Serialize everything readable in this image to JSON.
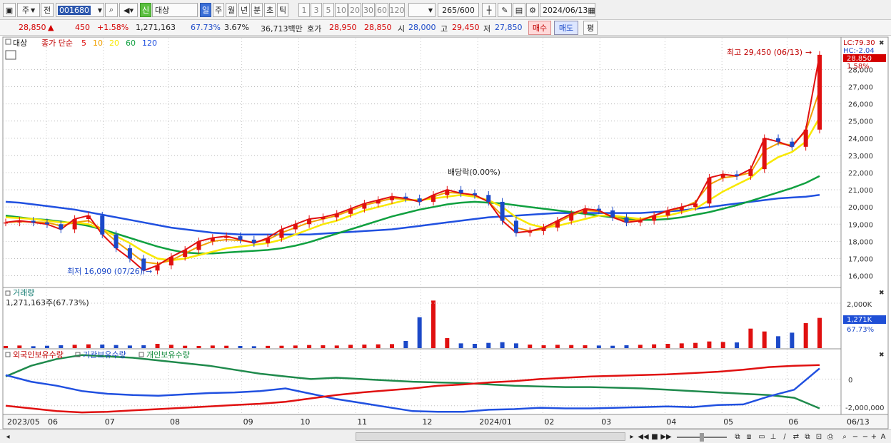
{
  "toolbar": {
    "type_select": "주",
    "mode_button": "전",
    "code": "001680",
    "new_badge": "신",
    "name": "대상",
    "periods": [
      "일",
      "주",
      "월",
      "년",
      "분",
      "초",
      "틱"
    ],
    "intervals": [
      "1",
      "3",
      "5",
      "10",
      "20",
      "30",
      "60",
      "120"
    ],
    "count": "265",
    "count_total": "/600",
    "date": "2024/06/13"
  },
  "quote": {
    "price": "28,850",
    "arrow": "▲",
    "change": "450",
    "change_pct": "+1.58%",
    "volume": "1,271,163",
    "volume_ratio": "67.73%",
    "turnover": "3.67%",
    "amount": "36,713백만",
    "hoga_label": "호가",
    "ask": "28,950",
    "bid": "28,850",
    "open_label": "시",
    "open": "28,000",
    "high_label": "고",
    "high": "29,450",
    "low_label": "저",
    "low": "27,850",
    "buy_button": "매수",
    "sell_button": "매도",
    "eval_button": "평"
  },
  "legend": {
    "stock": "대상",
    "series": "종가 단순",
    "ma": [
      "5",
      "10",
      "20",
      "60",
      "120"
    ],
    "ma_colors": [
      "#e01010",
      "#f0a000",
      "#f8e800",
      "#10a040",
      "#2050e0"
    ]
  },
  "annotations": {
    "high": "최고 29,450 (06/13)",
    "low": "최저 16,090 (07/26)",
    "dividend": "배당락(0.00%)"
  },
  "right_axis": {
    "lc": "LC:79.30",
    "hc": "HC:-2.04",
    "price_tag": "28,850",
    "pct_tag": "1.58%",
    "volume_tag": "1,271K",
    "volume_pct": "67.73%",
    "volume_top": "2,000K",
    "holding_zero": "0",
    "holding_low": "-2,000,000"
  },
  "volume_panel": {
    "title": "거래량",
    "value": "1,271,163주(67.73%)"
  },
  "holding_panel": {
    "foreign": "외국인보유수량",
    "institution": "기관보유수량",
    "individual": "개인보유수량"
  },
  "chart_data": {
    "type": "line",
    "x": [
      "2023/05",
      "06",
      "07",
      "08",
      "09",
      "10",
      "11",
      "12",
      "2024/01",
      "02",
      "03",
      "04",
      "05",
      "06"
    ],
    "yticks": [
      "16,000",
      "17,000",
      "18,000",
      "19,000",
      "20,000",
      "21,000",
      "22,000",
      "23,000",
      "24,000",
      "25,000",
      "26,000",
      "27,000",
      "28,000"
    ],
    "ylim": [
      15400,
      29800
    ],
    "close": [
      19100,
      19200,
      19100,
      19000,
      18700,
      19300,
      19500,
      18400,
      17600,
      17000,
      16300,
      16600,
      17100,
      17500,
      18000,
      18200,
      18300,
      18100,
      17900,
      18200,
      18700,
      19000,
      19300,
      19400,
      19600,
      19900,
      20200,
      20400,
      20600,
      20500,
      20300,
      20700,
      21000,
      20800,
      20700,
      20300,
      19200,
      18500,
      18600,
      18800,
      19200,
      19600,
      19900,
      19800,
      19400,
      19100,
      19200,
      19500,
      19800,
      20000,
      20200,
      21700,
      21900,
      21800,
      22200,
      24000,
      23800,
      23500,
      24500,
      28850
    ],
    "ma5": [
      19100,
      19150,
      19130,
      19100,
      18900,
      19100,
      19200,
      18700,
      18000,
      17400,
      16800,
      16700,
      16900,
      17300,
      17700,
      18000,
      18100,
      18050,
      17950,
      18100,
      18500,
      18800,
      19100,
      19300,
      19500,
      19800,
      20100,
      20300,
      20500,
      20450,
      20350,
      20600,
      20850,
      20800,
      20700,
      20300,
      19500,
      18800,
      18600,
      18700,
      19100,
      19500,
      19800,
      19750,
      19450,
      19200,
      19250,
      19500,
      19750,
      19950,
      20300,
      21300,
      21700,
      21800,
      22000,
      23300,
      23700,
      23600,
      24400,
      26800
    ],
    "ma20": [
      19400,
      19350,
      19300,
      19200,
      19100,
      19100,
      19000,
      18700,
      18300,
      17900,
      17400,
      17000,
      16900,
      17000,
      17200,
      17400,
      17600,
      17700,
      17800,
      17900,
      18100,
      18400,
      18700,
      19000,
      19200,
      19500,
      19800,
      20000,
      20200,
      20400,
      20400,
      20500,
      20600,
      20700,
      20600,
      20400,
      20000,
      19400,
      19000,
      18800,
      18900,
      19100,
      19300,
      19500,
      19500,
      19400,
      19300,
      19400,
      19500,
      19700,
      19900,
      20400,
      20900,
      21300,
      21700,
      22400,
      22900,
      23200,
      23800,
      25200
    ],
    "ma60": [
      19500,
      19400,
      19300,
      19250,
      19150,
      19050,
      18900,
      18700,
      18450,
      18200,
      17950,
      17700,
      17500,
      17350,
      17300,
      17300,
      17350,
      17400,
      17450,
      17500,
      17600,
      17750,
      17950,
      18200,
      18450,
      18700,
      18950,
      19200,
      19450,
      19650,
      19850,
      20000,
      20150,
      20250,
      20300,
      20250,
      20200,
      20100,
      20000,
      19900,
      19800,
      19700,
      19600,
      19500,
      19400,
      19300,
      19250,
      19250,
      19300,
      19400,
      19550,
      19700,
      19900,
      20100,
      20350,
      20600,
      20850,
      21100,
      21400,
      21800
    ],
    "ma120": [
      20300,
      20250,
      20150,
      20050,
      19950,
      19850,
      19700,
      19550,
      19400,
      19250,
      19100,
      18950,
      18800,
      18700,
      18600,
      18500,
      18450,
      18400,
      18400,
      18400,
      18400,
      18400,
      18400,
      18450,
      18500,
      18550,
      18600,
      18650,
      18700,
      18800,
      18900,
      19000,
      19100,
      19200,
      19300,
      19400,
      19450,
      19500,
      19550,
      19600,
      19650,
      19650,
      19650,
      19650,
      19650,
      19650,
      19650,
      19700,
      19750,
      19800,
      19900,
      20000,
      20100,
      20200,
      20300,
      20400,
      20500,
      20550,
      20600,
      20700
    ],
    "volume_max": 2400000,
    "volume": [
      90000,
      110000,
      80000,
      100000,
      120000,
      140000,
      160000,
      150000,
      130000,
      110000,
      120000,
      180000,
      140000,
      100000,
      90000,
      110000,
      100000,
      90000,
      80000,
      95000,
      100000,
      110000,
      130000,
      120000,
      110000,
      140000,
      150000,
      160000,
      170000,
      300000,
      1300000,
      2000000,
      420000,
      200000,
      180000,
      220000,
      250000,
      200000,
      150000,
      120000,
      140000,
      130000,
      120000,
      110000,
      100000,
      120000,
      140000,
      160000,
      180000,
      200000,
      220000,
      280000,
      260000,
      240000,
      820000,
      700000,
      500000,
      650000,
      1050000,
      1271163
    ],
    "holding": {
      "foreign": [
        -2000000,
        -2200000,
        -2400000,
        -2500000,
        -2450000,
        -2350000,
        -2250000,
        -2150000,
        -2050000,
        -1950000,
        -1850000,
        -1700000,
        -1450000,
        -1200000,
        -1000000,
        -850000,
        -700000,
        -500000,
        -400000,
        -250000,
        -150000,
        0,
        100000,
        200000,
        250000,
        300000,
        350000,
        450000,
        550000,
        700000,
        900000,
        1000000,
        1050000
      ],
      "institution": [
        300000,
        -200000,
        -500000,
        -900000,
        -1100000,
        -1200000,
        -1250000,
        -1150000,
        -1050000,
        -1000000,
        -900000,
        -700000,
        -1100000,
        -1500000,
        -1800000,
        -2100000,
        -2400000,
        -2450000,
        -2450000,
        -2300000,
        -2250000,
        -2150000,
        -2200000,
        -2200000,
        -2150000,
        -2100000,
        -2050000,
        -2100000,
        -1950000,
        -1900000,
        -1300000,
        -800000,
        800000
      ],
      "individual": [
        200000,
        1000000,
        1500000,
        1800000,
        1700000,
        1600000,
        1400000,
        1200000,
        1000000,
        700000,
        400000,
        200000,
        0,
        100000,
        0,
        -100000,
        -200000,
        -250000,
        -300000,
        -400000,
        -500000,
        -550000,
        -600000,
        -600000,
        -650000,
        -700000,
        -800000,
        -900000,
        -1000000,
        -1100000,
        -1200000,
        -1400000,
        -2200000
      ]
    }
  },
  "scroll": {
    "left_arrow": "◂",
    "right_arrow": "▸",
    "zoom_minus": "−",
    "zoom_plus": "+",
    "text_tool": "A"
  }
}
